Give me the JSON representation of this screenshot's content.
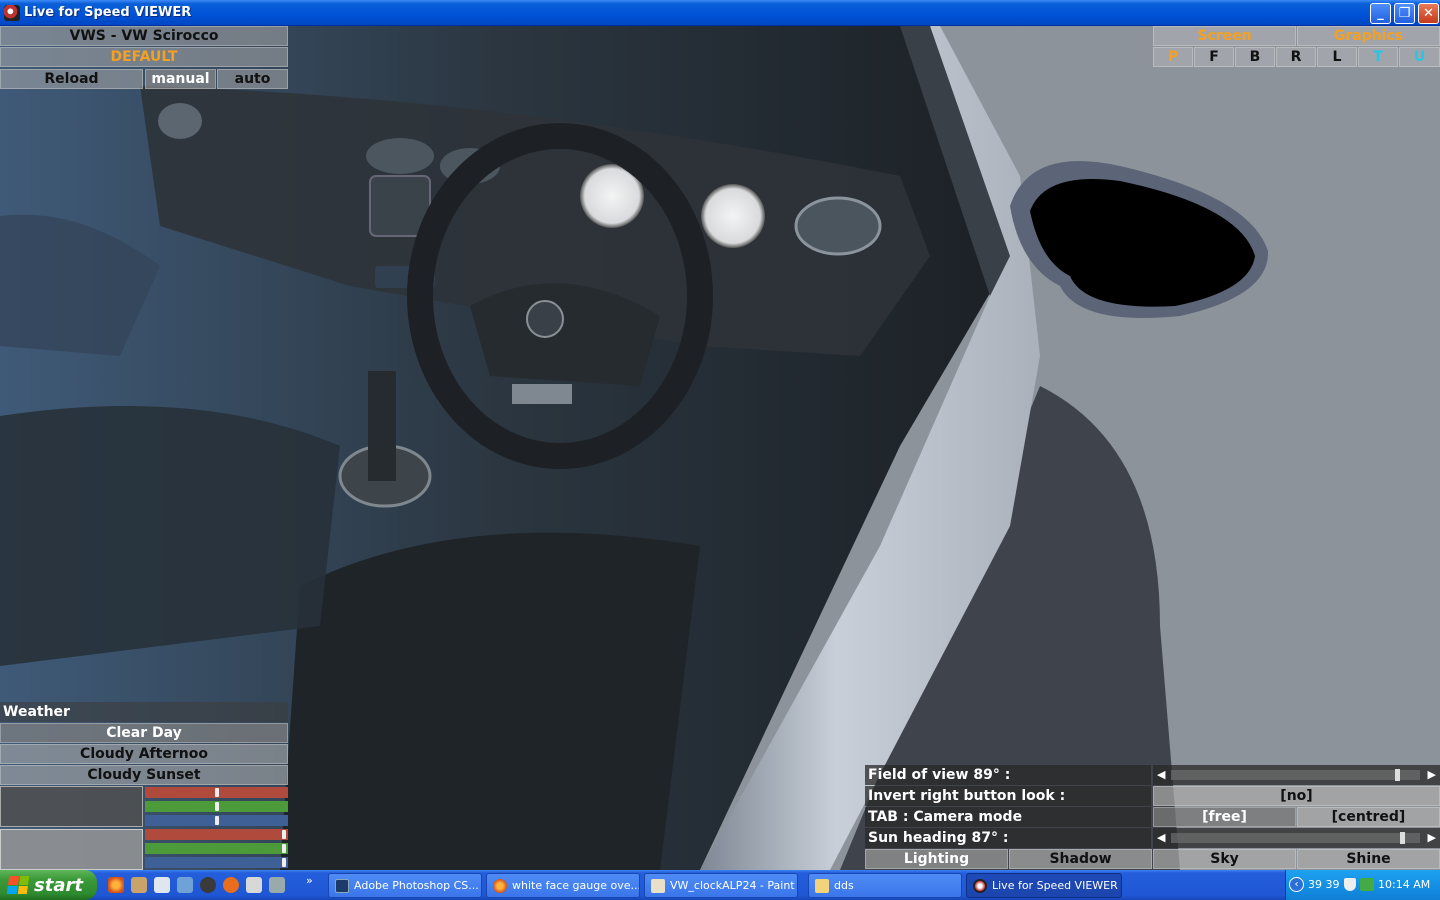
{
  "window": {
    "title": "Live for Speed VIEWER"
  },
  "car": {
    "name": "VWS - VW Scirocco",
    "skin": "DEFAULT",
    "reload_label": "Reload",
    "manual_label": "manual",
    "auto_label": "auto"
  },
  "view_tabs": {
    "screen_label": "Screen",
    "graphics_label": "Graphics",
    "letters": [
      "P",
      "F",
      "B",
      "R",
      "L",
      "T",
      "U"
    ]
  },
  "weather": {
    "title": "Weather",
    "options": [
      "Clear Day",
      "Cloudy Afternoo",
      "Cloudy Sunset"
    ],
    "sliders_top": [
      0.5,
      0.5,
      0.5
    ],
    "sliders_bottom": [
      1.0,
      1.0,
      1.0
    ]
  },
  "settings": {
    "fov_label": "Field of view 89° :",
    "fov_level": 0.9,
    "invert_label": "Invert right button look :",
    "invert_value": "[no]",
    "camera_label": "TAB : Camera mode",
    "camera_free": "[free]",
    "camera_centred": "[centred]",
    "sun_label": "Sun heading 87° :",
    "sun_level": 0.92,
    "tabs": [
      "Lighting",
      "Shadow",
      "Sky",
      "Shine"
    ]
  },
  "taskbar": {
    "start_label": "start",
    "tasks": [
      {
        "label": "Adobe Photoshop CS...",
        "icon": "photoshop-icon"
      },
      {
        "label": "white face gauge ove...",
        "icon": "firefox-icon"
      },
      {
        "label": "VW_clockALP24 - Paint",
        "icon": "paint-icon"
      },
      {
        "label": "dds",
        "icon": "folder-icon"
      },
      {
        "label": "Live for Speed VIEWER",
        "icon": "lfs-icon"
      }
    ],
    "tray_numbers": "39 39",
    "clock": "10:14 AM"
  },
  "colors": {
    "orange": "#f5a020",
    "cyan": "#22c8e8",
    "xp_blue": "#0052d6",
    "start_green": "#3c9a39"
  }
}
